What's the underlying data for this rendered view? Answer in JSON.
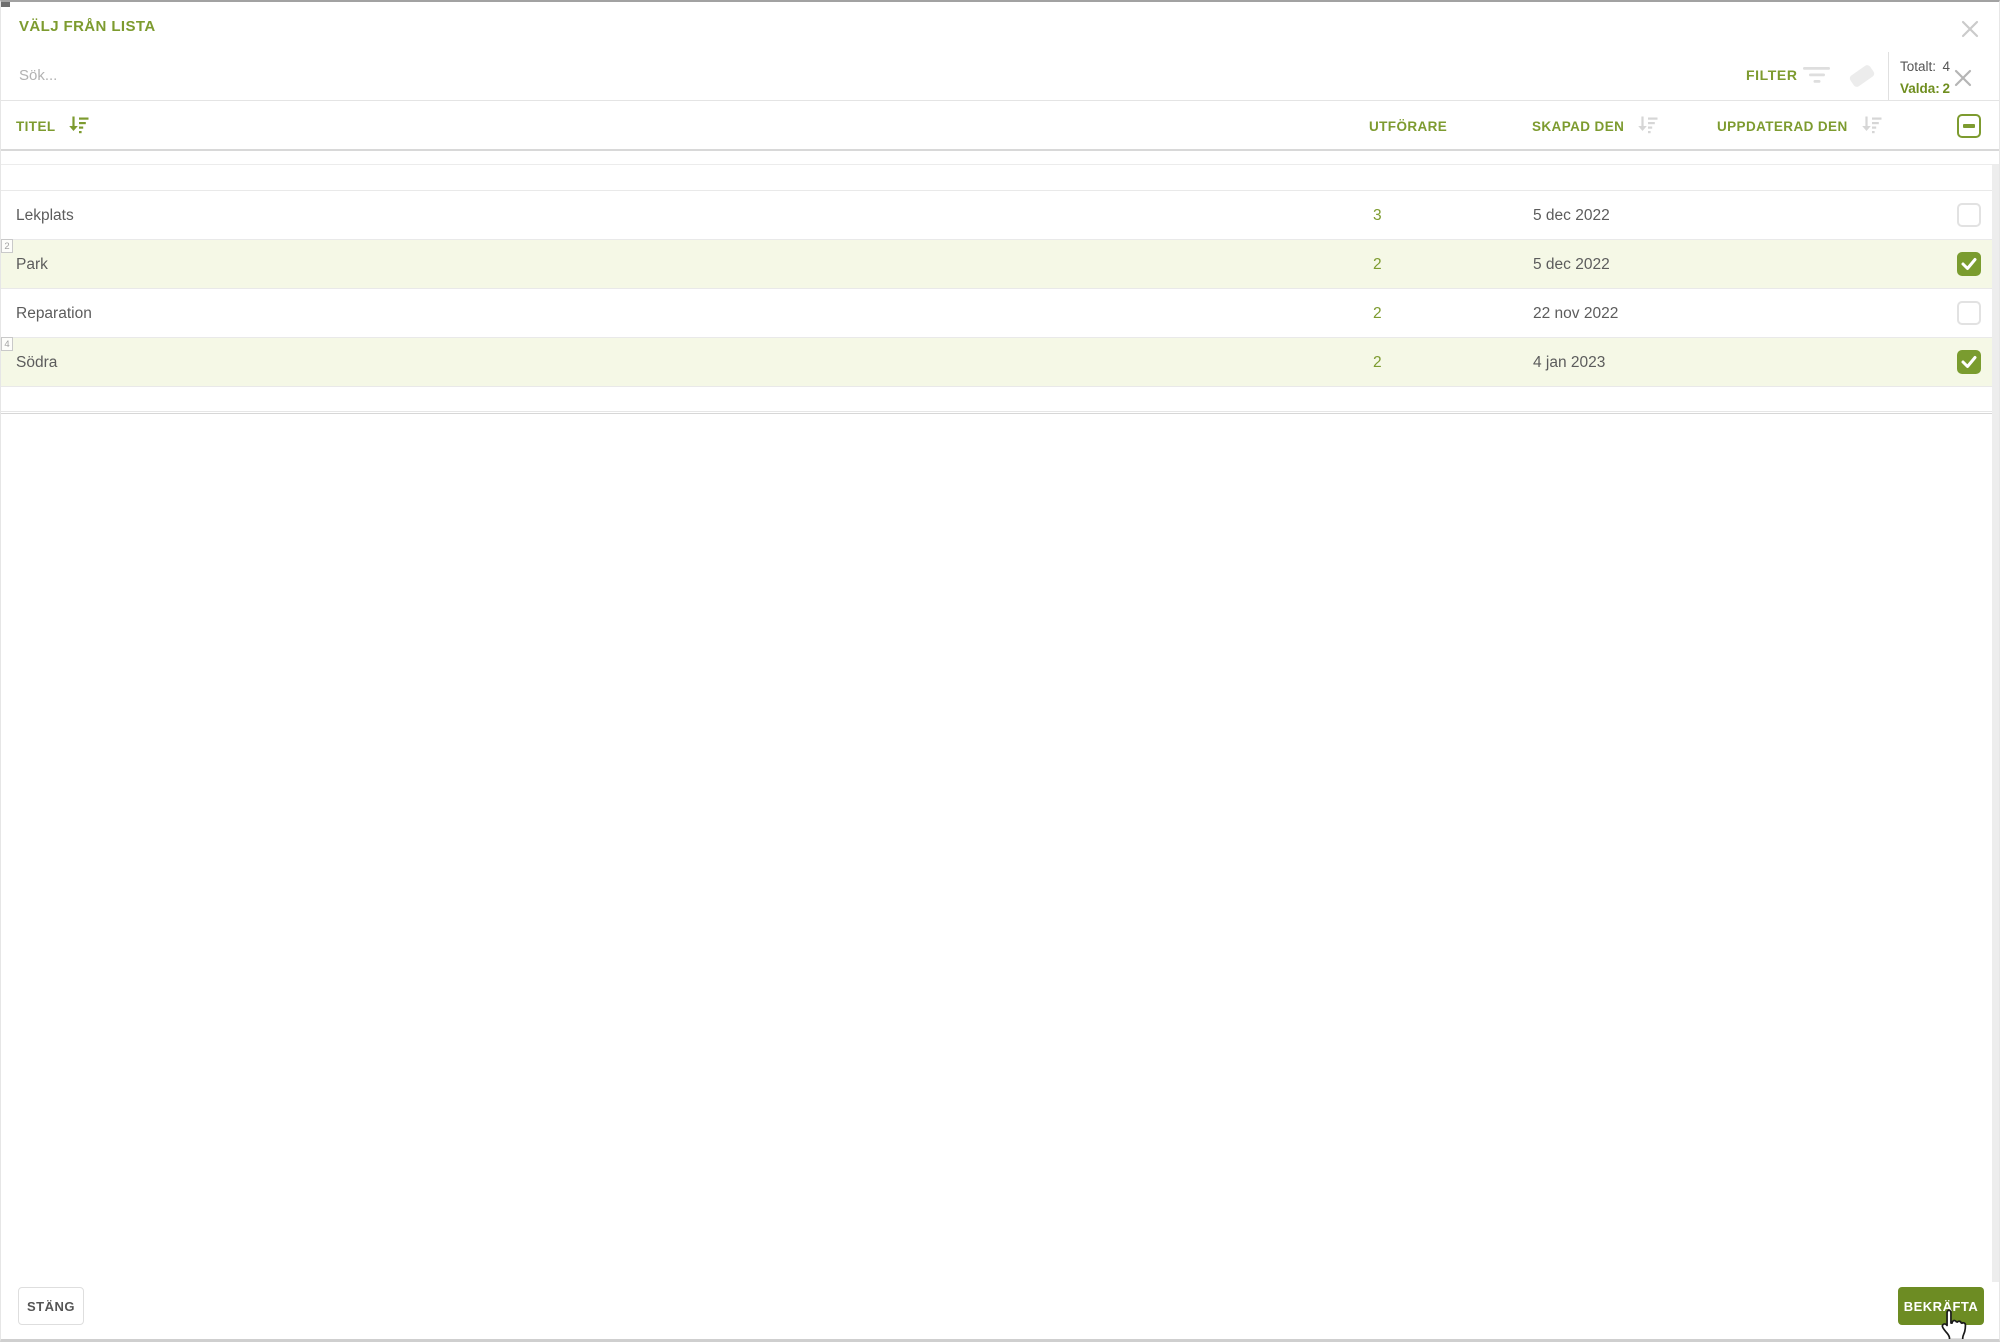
{
  "modal": {
    "title": "VÄLJ FRÅN LISTA"
  },
  "search": {
    "placeholder": "Sök..."
  },
  "filter": {
    "label": "FILTER"
  },
  "totals": {
    "total_label": "Totalt:",
    "total_value": "4",
    "selected_label": "Valda:",
    "selected_value": "2"
  },
  "table": {
    "columns": {
      "titel": "TITEL",
      "utforare": "UTFÖRARE",
      "skapad_den": "SKAPAD DEN",
      "uppdaterad_den": "UPPDATERAD DEN"
    },
    "sorted_column": "titel",
    "header_checkbox_state": "indeterminate",
    "rows": [
      {
        "badge": "",
        "titel": "Lekplats",
        "utforare": "3",
        "skapad_den": "5 dec 2022",
        "uppdaterad_den": "",
        "checked": false
      },
      {
        "badge": "2",
        "titel": "Park",
        "utforare": "2",
        "skapad_den": "5 dec 2022",
        "uppdaterad_den": "",
        "checked": true
      },
      {
        "badge": "",
        "titel": "Reparation",
        "utforare": "2",
        "skapad_den": "22 nov 2022",
        "uppdaterad_den": "",
        "checked": false
      },
      {
        "badge": "4",
        "titel": "Södra",
        "utforare": "2",
        "skapad_den": "4 jan 2023",
        "uppdaterad_den": "",
        "checked": true
      }
    ]
  },
  "footer": {
    "close_label": "STÄNG",
    "confirm_label": "BEKRÄFTA"
  },
  "icons": {
    "close": "x-icon",
    "filter": "funnel-lines-icon",
    "clear_filter": "eraser-icon",
    "clear_selection": "x-icon",
    "sort": "sort-descending-icon",
    "cursor": "pointer-hand"
  },
  "colors": {
    "accent_green": "#7d9b2f",
    "button_green": "#6d8c23",
    "selected_row_bg": "#f5f8e6",
    "checkbox_checked": "#7a9c2f"
  }
}
